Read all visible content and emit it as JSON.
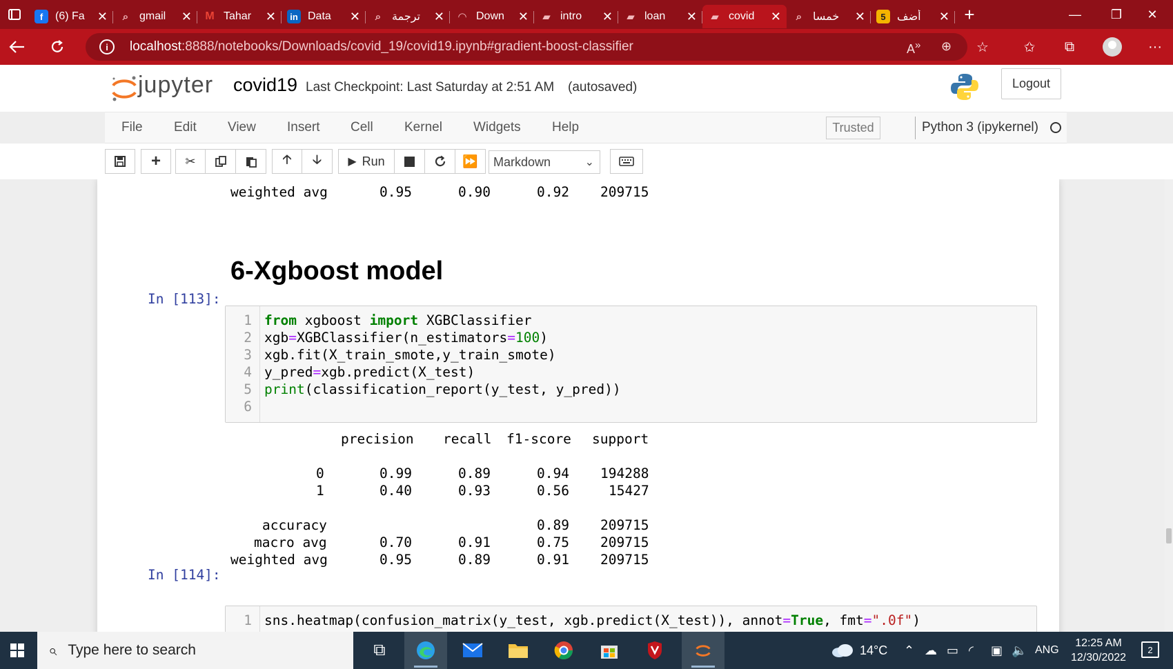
{
  "browser": {
    "tabs": [
      {
        "label": "(6) Fa",
        "icon": "facebook-icon",
        "icon_text": "f",
        "color": "#1877f2"
      },
      {
        "label": "gmail",
        "icon": "search-icon",
        "icon_text": "⌕",
        "color": "#8f1018"
      },
      {
        "label": "Tahar",
        "icon": "gmail-icon",
        "icon_text": "M",
        "color": "#ea4335"
      },
      {
        "label": "Data",
        "icon": "linkedin-icon",
        "icon_text": "in",
        "color": "#0a66c2"
      },
      {
        "label": "ترجمة",
        "icon": "search-icon",
        "icon_text": "⌕",
        "color": "#8f1018"
      },
      {
        "label": "Down",
        "icon": "loading-icon",
        "icon_text": "◠",
        "color": "#8f1018"
      },
      {
        "label": "intro",
        "icon": "notebook-icon",
        "icon_text": "▰",
        "color": "#8f1018"
      },
      {
        "label": "loan",
        "icon": "notebook-icon",
        "icon_text": "▰",
        "color": "#8f1018"
      },
      {
        "label": "covid",
        "icon": "notebook-icon",
        "icon_text": "▰",
        "color": "#b9141c",
        "active": true
      },
      {
        "label": "خمسا",
        "icon": "search-icon",
        "icon_text": "⌕",
        "color": "#8f1018"
      },
      {
        "label": "أضف",
        "icon": "khamsat-icon",
        "icon_text": "5",
        "color": "#f4b400"
      }
    ],
    "url_host": "localhost",
    "url_rest": ":8888/notebooks/Downloads/covid_19/covid19.ipynb#gradient-boost-classifier"
  },
  "jupyter": {
    "brand": "jupyter",
    "notebook_name": "covid19",
    "checkpoint": "Last Checkpoint: Last Saturday at 2:51 AM",
    "autosave": "(autosaved)",
    "logout": "Logout",
    "menu": [
      "File",
      "Edit",
      "View",
      "Insert",
      "Cell",
      "Kernel",
      "Widgets",
      "Help"
    ],
    "trusted": "Trusted",
    "kernel": "Python 3 (ipykernel)",
    "run_label": "Run",
    "cell_type": "Markdown"
  },
  "notebook": {
    "prev_weighted": {
      "label": "weighted avg",
      "precision": "0.95",
      "recall": "0.90",
      "f1": "0.92",
      "support": "209715"
    },
    "heading": "6-Xgboost model",
    "cell113": {
      "prompt": "In [113]:",
      "line_numbers": [
        "1",
        "2",
        "3",
        "4",
        "5",
        "6"
      ]
    },
    "report": {
      "headers": [
        "precision",
        "recall",
        "f1-score",
        "support"
      ],
      "rows": [
        {
          "label": "0",
          "precision": "0.99",
          "recall": "0.89",
          "f1": "0.94",
          "support": "194288"
        },
        {
          "label": "1",
          "precision": "0.40",
          "recall": "0.93",
          "f1": "0.56",
          "support": "15427"
        }
      ],
      "accuracy": {
        "label": "accuracy",
        "f1": "0.89",
        "support": "209715"
      },
      "macro": {
        "label": "macro avg",
        "precision": "0.70",
        "recall": "0.91",
        "f1": "0.75",
        "support": "209715"
      },
      "weighted": {
        "label": "weighted avg",
        "precision": "0.95",
        "recall": "0.89",
        "f1": "0.91",
        "support": "209715"
      }
    },
    "cell114": {
      "prompt": "In [114]:",
      "line_number": "1"
    }
  },
  "taskbar": {
    "search_placeholder": "Type here to search",
    "weather": "14°C",
    "language": "ANG",
    "time": "12:25 AM",
    "date": "12/30/2022",
    "notifications": "2"
  }
}
